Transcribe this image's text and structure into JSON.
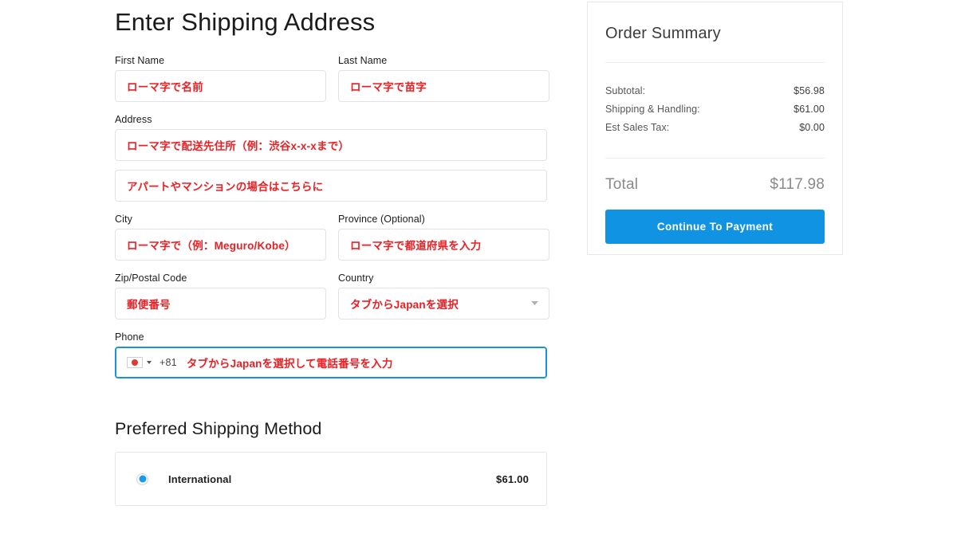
{
  "form": {
    "title": "Enter Shipping Address",
    "fields": [
      {
        "label": "First Name",
        "value": "ローマ字で名前"
      },
      {
        "label": "Last Name",
        "value": "ローマ字で苗字"
      },
      {
        "label": "Address",
        "value": "ローマ字で配送先住所（例：渋谷x-x-xまで）"
      },
      {
        "label": "",
        "value": "アパートやマンションの場合はこちらに"
      },
      {
        "label": "City",
        "value": "ローマ字で（例：Meguro/Kobe）"
      },
      {
        "label": "Province (Optional)",
        "value": "ローマ字で都道府県を入力"
      },
      {
        "label": "Zip/Postal Code",
        "value": "郵便番号"
      },
      {
        "label": "Country",
        "value": "タブからJapanを選択"
      },
      {
        "label": "Phone",
        "value": "タブからJapanを選択して電話番号を入力"
      }
    ],
    "phone": {
      "dial_code": "+81",
      "flag": "japan-flag-icon"
    }
  },
  "shipping": {
    "section_title": "Preferred Shipping Method",
    "options": [
      {
        "name": "International",
        "price": "$61.00",
        "selected": true
      }
    ]
  },
  "summary": {
    "title": "Order Summary",
    "lines": [
      {
        "label": "Subtotal:",
        "value": "$56.98"
      },
      {
        "label": "Shipping & Handling:",
        "value": "$61.00"
      },
      {
        "label": "Est Sales Tax:",
        "value": "$0.00"
      }
    ],
    "total_label": "Total",
    "total_value": "$117.98",
    "cta_label": "Continue To Payment"
  },
  "colors": {
    "accent_blue": "#1193e4",
    "hint_red": "#ec2024",
    "border_grey": "#e2e2e2"
  }
}
